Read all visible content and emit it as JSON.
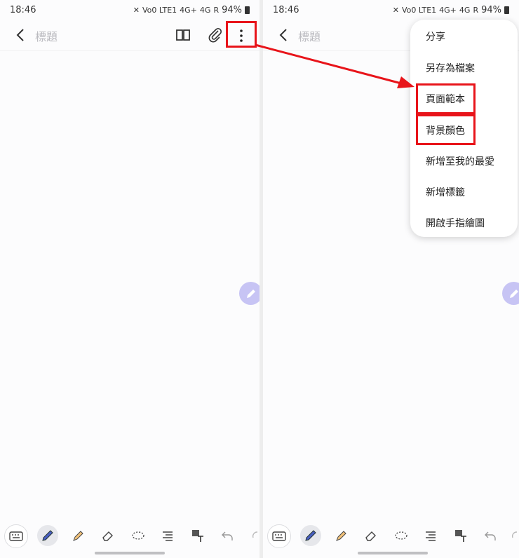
{
  "status_bar": {
    "time": "18:46",
    "battery": "94%",
    "net1": "Vo0 LTE1",
    "net2": "4G+",
    "net3": "4G",
    "net4": "R"
  },
  "app_bar": {
    "title_placeholder": "標題"
  },
  "menu": {
    "items": [
      "分享",
      "另存為檔案",
      "頁面範本",
      "背景顏色",
      "新增至我的最愛",
      "新增標籤",
      "開啟手指繪圖"
    ]
  },
  "colors": {
    "highlight": "#e8141a",
    "fab": "#c7c4f4",
    "pen": "#4a5fc1",
    "highlighter": "#f2c27a"
  },
  "toolbar": {
    "icons": [
      "keyboard-icon",
      "pen-icon",
      "highlighter-icon",
      "eraser-icon",
      "lasso-icon",
      "text-align-icon",
      "image-text-icon",
      "undo-icon",
      "redo-icon"
    ]
  }
}
